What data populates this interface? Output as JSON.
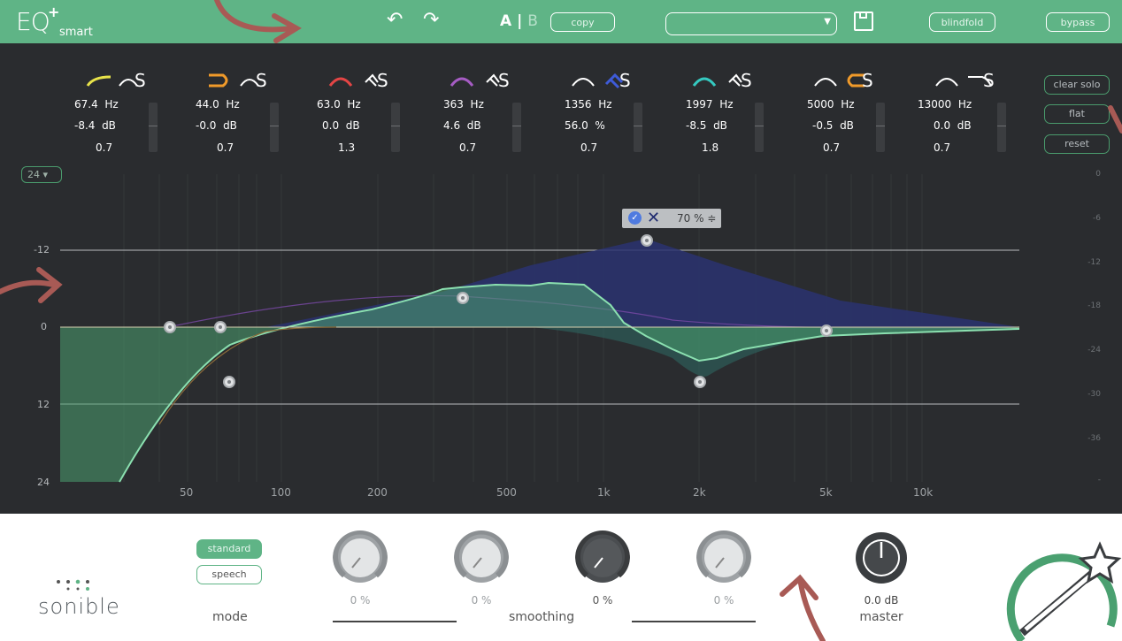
{
  "app": {
    "logo_main": "EQ",
    "logo_plus": "+",
    "logo_sub": "smart"
  },
  "toolbar": {
    "undo_icon": "undo-icon",
    "redo_icon": "redo-icon",
    "ab_a": "A",
    "ab_b": "B",
    "copy_label": "copy",
    "preset_value": "",
    "blindfold_label": "blindfold",
    "bypass_label": "bypass"
  },
  "bands": [
    {
      "hz": "67.4",
      "unit1": "Hz",
      "gain": "-8.4",
      "unit2": "dB",
      "q": "0.7",
      "color": "#e8e34a",
      "solo": "S"
    },
    {
      "hz": "44.0",
      "unit1": "Hz",
      "gain": "-0.0",
      "unit2": "dB",
      "q": "0.7",
      "color": "#f09a2a",
      "solo": "S"
    },
    {
      "hz": "63.0",
      "unit1": "Hz",
      "gain": "0.0",
      "unit2": "dB",
      "q": "1.3",
      "color": "#e44545",
      "solo": "S"
    },
    {
      "hz": "363",
      "unit1": "Hz",
      "gain": "4.6",
      "unit2": "dB",
      "q": "0.7",
      "color": "#a65cc4",
      "solo": "S"
    },
    {
      "hz": "1356",
      "unit1": "Hz",
      "gain": "56.0",
      "unit2": "%",
      "q": "0.7",
      "color": "#3e5bd8",
      "solo": "S"
    },
    {
      "hz": "1997",
      "unit1": "Hz",
      "gain": "-8.5",
      "unit2": "dB",
      "q": "1.8",
      "color": "#35c9c0",
      "solo": "S"
    },
    {
      "hz": "5000",
      "unit1": "Hz",
      "gain": "-0.5",
      "unit2": "dB",
      "q": "0.7",
      "color": "#f09a2a",
      "solo": "S"
    },
    {
      "hz": "13000",
      "unit1": "Hz",
      "gain": "0.0",
      "unit2": "dB",
      "q": "0.7",
      "color": "#ffffff",
      "solo": "S"
    }
  ],
  "side": {
    "clear_solo": "clear solo",
    "flat": "flat",
    "reset": "reset"
  },
  "range_select": "24 ▾",
  "graph": {
    "y_labels": [
      "-12",
      "0",
      "12",
      "24"
    ],
    "right_labels": [
      "0",
      "-6",
      "-12",
      "-18",
      "-24",
      "-30",
      "-36",
      "-"
    ],
    "x_labels": [
      "50",
      "100",
      "200",
      "500",
      "1k",
      "2k",
      "5k",
      "10k"
    ],
    "tooltip_pct": "70 % ≑"
  },
  "bottom": {
    "brand": "sonible",
    "mode_standard": "standard",
    "mode_speech": "speech",
    "mode_label": "mode",
    "knob_values": [
      "0 %",
      "0 %",
      "0 %",
      "0 %"
    ],
    "smoothing_label": "smoothing",
    "master_value": "0.0 dB",
    "master_label": "master"
  },
  "colors": {
    "accent": "#5fb486",
    "panel": "#2a2c2f",
    "curve": "#6fd49a"
  }
}
